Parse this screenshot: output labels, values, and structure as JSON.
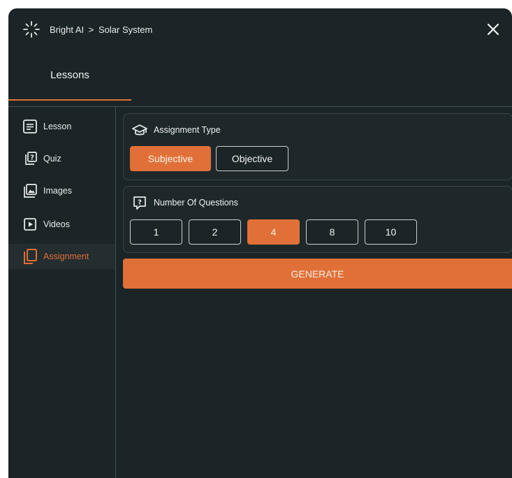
{
  "header": {
    "app_name": "Bright AI",
    "separator": ">",
    "page": "Solar System"
  },
  "tabs": [
    {
      "label": "Lessons",
      "active": true
    }
  ],
  "sidebar": {
    "items": [
      {
        "label": "Lesson",
        "icon": "lesson-icon"
      },
      {
        "label": "Quiz",
        "icon": "quiz-icon"
      },
      {
        "label": "Images",
        "icon": "image-icon"
      },
      {
        "label": "Videos",
        "icon": "video-icon"
      },
      {
        "label": "Assignment",
        "icon": "assignment-icon",
        "active": true
      }
    ]
  },
  "assignment_type": {
    "title": "Assignment Type",
    "icon": "graduation-cap-icon",
    "options": [
      "Subjective",
      "Objective"
    ],
    "selected": "Subjective"
  },
  "questions": {
    "title": "Number Of Questions",
    "icon": "question-box-icon",
    "options": [
      "1",
      "2",
      "4",
      "8",
      "10"
    ],
    "selected": "4"
  },
  "generate_label": "GENERATE",
  "colors": {
    "accent": "#e07038",
    "background": "#1b2527",
    "panel": "#1e282a",
    "border": "#3a4547",
    "text": "#e9ecec"
  }
}
